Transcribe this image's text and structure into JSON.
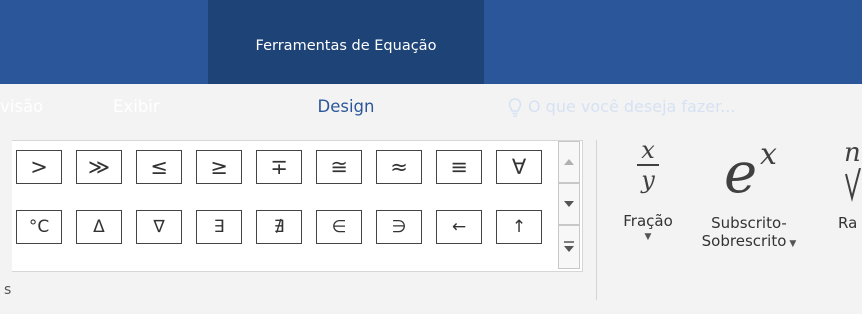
{
  "contextual_tab_group": {
    "title": "Ferramentas de Equação"
  },
  "tabs": [
    {
      "label": "visão"
    },
    {
      "label": "Exibir"
    },
    {
      "label": "Design"
    }
  ],
  "tell_me": {
    "text": "O que você deseja fazer..."
  },
  "symbols": {
    "row1": [
      ">",
      "≫",
      "≤",
      "≥",
      "∓",
      "≅",
      "≈",
      "≡",
      "∀"
    ],
    "row2": [
      "°C",
      "Δ",
      "∇",
      "∃",
      "∄",
      "∈",
      "∋",
      "←",
      "↑"
    ]
  },
  "tools": {
    "fraction": {
      "label": "Fração",
      "numerator": "x",
      "denominator": "y"
    },
    "script": {
      "label_line1": "Subscrito-",
      "label_line2": "Sobrescrito",
      "base": "e",
      "exponent": "x"
    },
    "radical": {
      "label": "Ra",
      "index": "n"
    }
  },
  "group_label_fragment": "s",
  "colors": {
    "ribbon_blue": "#2b579a",
    "context_blue": "#1e4377",
    "ribbon_bg": "#f3f3f3"
  },
  "icons": {
    "tell_me": "lightbulb-icon",
    "caret": "caret-down-icon"
  }
}
